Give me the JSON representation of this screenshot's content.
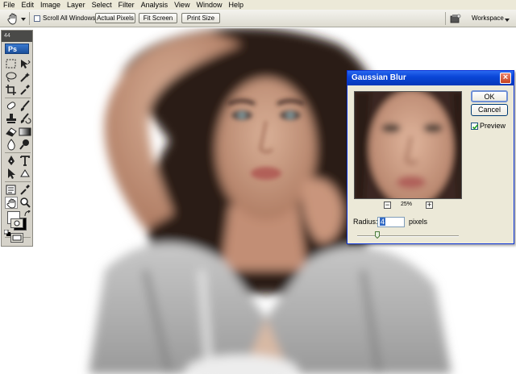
{
  "menu": [
    "File",
    "Edit",
    "Image",
    "Layer",
    "Select",
    "Filter",
    "Analysis",
    "View",
    "Window",
    "Help"
  ],
  "options_bar": {
    "tool_icon": "hand-icon",
    "scroll_all_windows_label": "Scroll All Windows",
    "scroll_all_windows_checked": false,
    "buttons": [
      "Actual Pixels",
      "Fit Screen",
      "Print Size"
    ],
    "workspace_label": "Workspace"
  },
  "tools_panel": {
    "collapse_label": "44",
    "logo": "Ps",
    "tools": [
      "marquee-icon",
      "move-icon",
      "lasso-icon",
      "magic-wand-icon",
      "crop-icon",
      "eyedropper-icon",
      "healing-brush-icon",
      "brush-icon",
      "clone-stamp-icon",
      "history-brush-icon",
      "eraser-icon",
      "gradient-icon",
      "blur-icon",
      "dodge-icon",
      "pen-icon",
      "type-icon",
      "path-selection-icon",
      "shape-icon",
      "notes-icon",
      "eyedropper-2-icon",
      "hand-icon",
      "zoom-icon"
    ],
    "foreground_color": "#ffffff",
    "background_color": "#000000"
  },
  "dialog": {
    "title": "Gaussian Blur",
    "ok_label": "OK",
    "cancel_label": "Cancel",
    "preview_label": "Preview",
    "preview_checked": true,
    "zoom_level": "25%",
    "zoom_out_label": "−",
    "zoom_in_label": "+",
    "radius_label": "Radius:",
    "radius_value": "4",
    "radius_unit": "pixels",
    "slider_position": 0.2
  },
  "colors": {
    "titlebar": "#0a46d8",
    "dialog_bg": "#ece9d8",
    "toolbar_bg": "#d6d3ca"
  }
}
